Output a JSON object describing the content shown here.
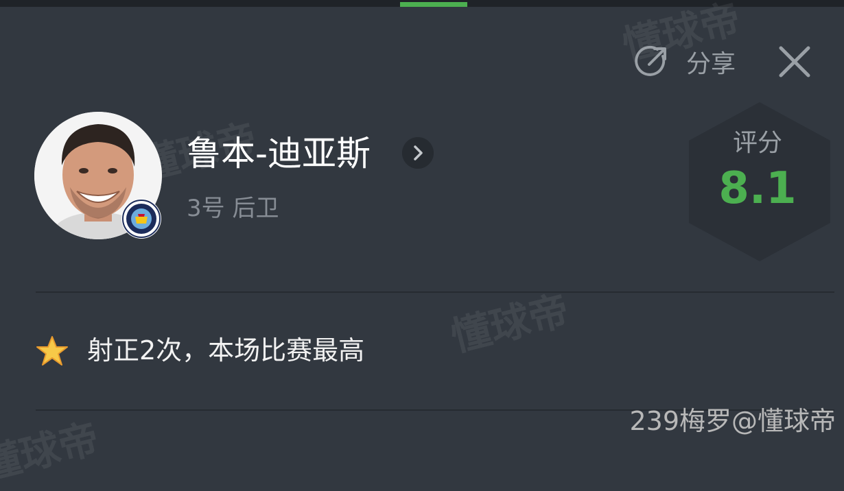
{
  "header": {
    "share_label": "分享",
    "share_icon": "share-icon",
    "close_icon": "close-icon",
    "active_tab_color": "#4caf50"
  },
  "player": {
    "name": "鲁本-迪亚斯",
    "number_position": "3号 后卫",
    "avatar_icon": "player-avatar",
    "club_badge_icon": "manchester-city-badge",
    "detail_icon": "chevron-right-icon"
  },
  "rating": {
    "label": "评分",
    "value": "8.1",
    "color": "#4caf50"
  },
  "highlights": [
    {
      "icon": "star-icon",
      "text": "射正2次，本场比赛最高"
    }
  ],
  "watermarks": [
    "懂球帝",
    "懂球帝",
    "懂球帝",
    "懂球帝"
  ],
  "attribution": "239梅罗@懂球帝"
}
